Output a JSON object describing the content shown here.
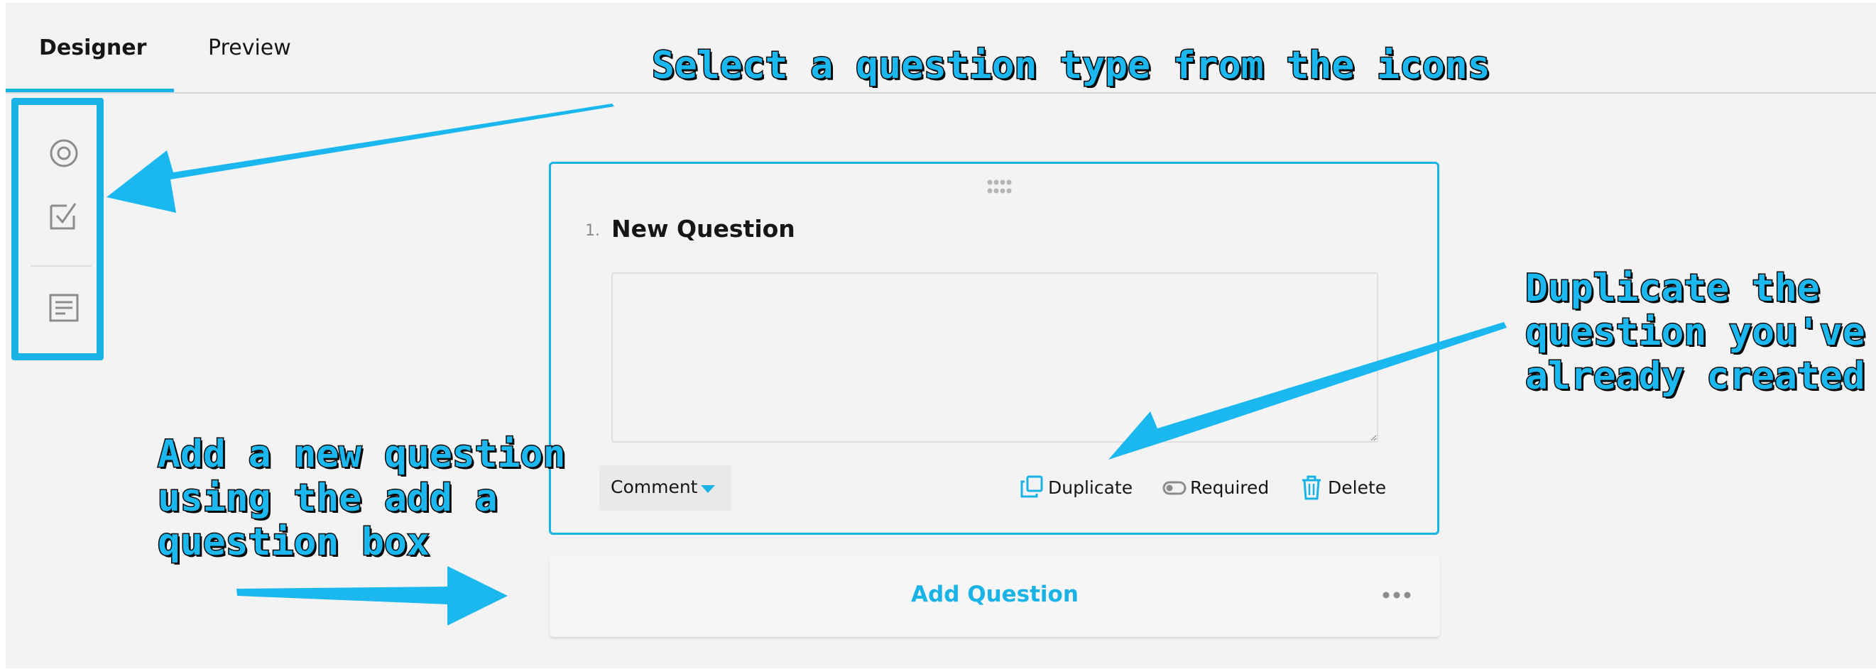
{
  "tabs": {
    "designer": "Designer",
    "preview": "Preview"
  },
  "toolbox": {
    "tools": [
      {
        "icon": "radiogroup-icon"
      },
      {
        "icon": "checkbox-icon"
      },
      {
        "icon": "comment-icon"
      }
    ]
  },
  "question": {
    "number": "1.",
    "title": "New Question",
    "answer_value": "",
    "type_label": "Comment",
    "actions": {
      "duplicate": "Duplicate",
      "required": "Required",
      "delete": "Delete"
    }
  },
  "add_question": {
    "label": "Add Question"
  },
  "annotations": {
    "select_type": "Select a question type from the icons",
    "duplicate": "Duplicate the\nquestion you've\nalready created",
    "add_new": "Add a new question\nusing the add a\nquestion box"
  },
  "colors": {
    "accent": "#19b3e6",
    "annotation_text": "#1ab8ee",
    "annotation_outline": "#0a0a0a"
  }
}
